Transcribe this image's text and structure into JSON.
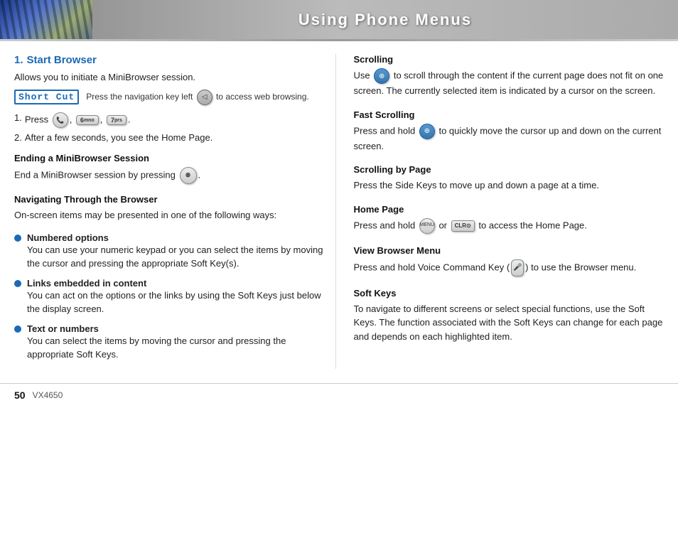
{
  "header": {
    "title": "Using Phone Menus"
  },
  "left": {
    "section_number": "1.",
    "section_title": "Start Browser",
    "intro": "Allows you to initiate a MiniBrowser session.",
    "shortcut_label": "Short Cut",
    "shortcut_text": "Press the navigation key left",
    "shortcut_text2": "to access web browsing.",
    "steps": [
      {
        "num": "1.",
        "text": "Press"
      },
      {
        "num": "2.",
        "text": "After a few seconds, you see the Home Page."
      }
    ],
    "ending_heading": "Ending a MiniBrowser Session",
    "ending_text": "End a MiniBrowser session by pressing",
    "navigating_heading": "Navigating Through the Browser",
    "navigating_text": "On-screen items may be presented in one of the following ways:",
    "bullets": [
      {
        "title": "Numbered options",
        "desc": "You can use your numeric keypad or you can select the items by moving the cursor and pressing the appropriate Soft Key(s)."
      },
      {
        "title": "Links embedded in content",
        "desc": "You can act on the options or the links by using the Soft Keys just below the display screen."
      },
      {
        "title": "Text or numbers",
        "desc": "You can select the items by moving the cursor and pressing the appropriate Soft Keys."
      }
    ]
  },
  "right": {
    "sections": [
      {
        "heading": "Scrolling",
        "text": "Use",
        "text2": "to scroll through the content if the current page does not fit on one screen. The currently selected item is indicated by a cursor on the screen."
      },
      {
        "heading": "Fast Scrolling",
        "text": "Press and hold",
        "text2": "to quickly move the cursor up and down on the current screen."
      },
      {
        "heading": "Scrolling by Page",
        "text": "Press the Side Keys to move up and down a page at a time."
      },
      {
        "heading": "Home Page",
        "text": "Press and hold",
        "text2": "or",
        "text3": "to access the Home Page."
      },
      {
        "heading": "View Browser Menu",
        "text": "Press and hold Voice Command Key (",
        "text2": ") to use the Browser menu."
      },
      {
        "heading": "Soft Keys",
        "text": "To navigate to different screens or select special functions, use the Soft Keys. The function associated with the Soft Keys can change for each page and depends on each highlighted item."
      }
    ]
  },
  "footer": {
    "page": "50",
    "model": "VX4650"
  }
}
